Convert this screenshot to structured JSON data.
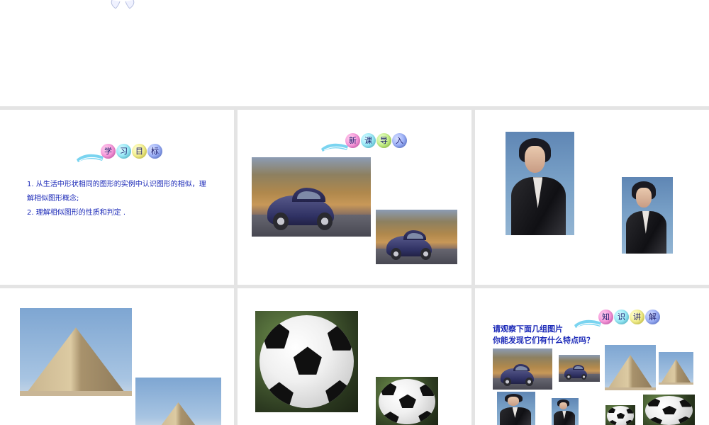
{
  "slides": {
    "objectives": {
      "badge_chars": [
        "学",
        "习",
        "目",
        "标"
      ],
      "items": [
        "1. 从生活中形状相同的图形的实例中认识图形的相似，理解相似图形概念;",
        "2. 理解相似图形的性质和判定 ."
      ]
    },
    "intro": {
      "badge_chars": [
        "新",
        "课",
        "导",
        "入"
      ]
    },
    "knowledge": {
      "badge_chars": [
        "知",
        "识",
        "讲",
        "解"
      ],
      "question_line1": "请观察下面几组图片",
      "question_line2": "你能发现它们有什么特点吗？"
    }
  },
  "images": {
    "car": "car-photo",
    "person": "person-photo",
    "pyramid": "pyramid-photo",
    "football": "football-photo"
  }
}
